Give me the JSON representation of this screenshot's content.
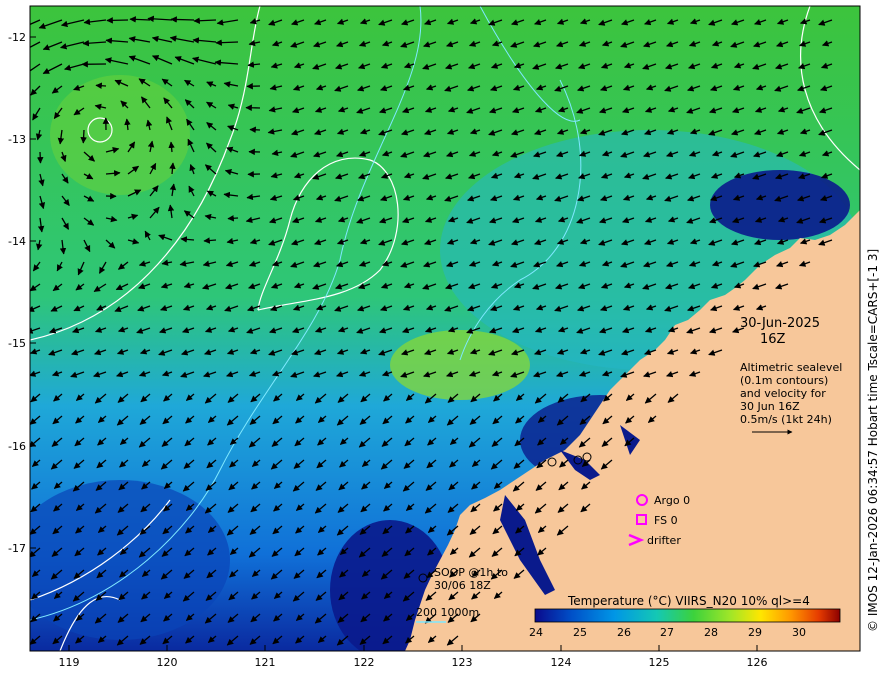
{
  "map": {
    "date": "30-Jun-2025",
    "time": "16Z",
    "legend_lines": [
      "Altimetric sealevel",
      "(0.1m contours)",
      "and velocity for",
      "30 Jun 16Z",
      "0.5m/s (1kt 24h)"
    ],
    "markers": {
      "argo": "Argo 0",
      "fs": "FS 0",
      "drifter": "drifter"
    },
    "soop_lines": [
      "SOOP @1h to",
      "30/06 18Z"
    ],
    "bathy_label": "200  1000m",
    "side_credit": "© IMOS 12-Jan-2026 06:34:57 Hobart time Tscale=CARS+[-1 3]",
    "colorbar": {
      "title": "Temperature (°C) VIIRS_N20 10% ql>=4",
      "ticks": [
        "24",
        "25",
        "26",
        "27",
        "28",
        "29",
        "30"
      ],
      "colors": [
        "#0a0a8c",
        "#0050c8",
        "#0096e6",
        "#14c8b4",
        "#3cd23c",
        "#a0e628",
        "#ffe600",
        "#ff9600",
        "#e63c00",
        "#8c0000"
      ]
    },
    "x_ticks": [
      "119",
      "120",
      "121",
      "122",
      "123",
      "124",
      "125",
      "126"
    ],
    "y_ticks": [
      "-12",
      "-13",
      "-14",
      "-15",
      "-16",
      "-17"
    ],
    "colors": {
      "land": "#f7c79a",
      "ocean_green": "#3fbf3f",
      "ocean_teal": "#2fc8a0",
      "ocean_blue": "#1a8fe0",
      "ocean_deep": "#0a1a8c",
      "marker": "#ff00ff"
    }
  }
}
